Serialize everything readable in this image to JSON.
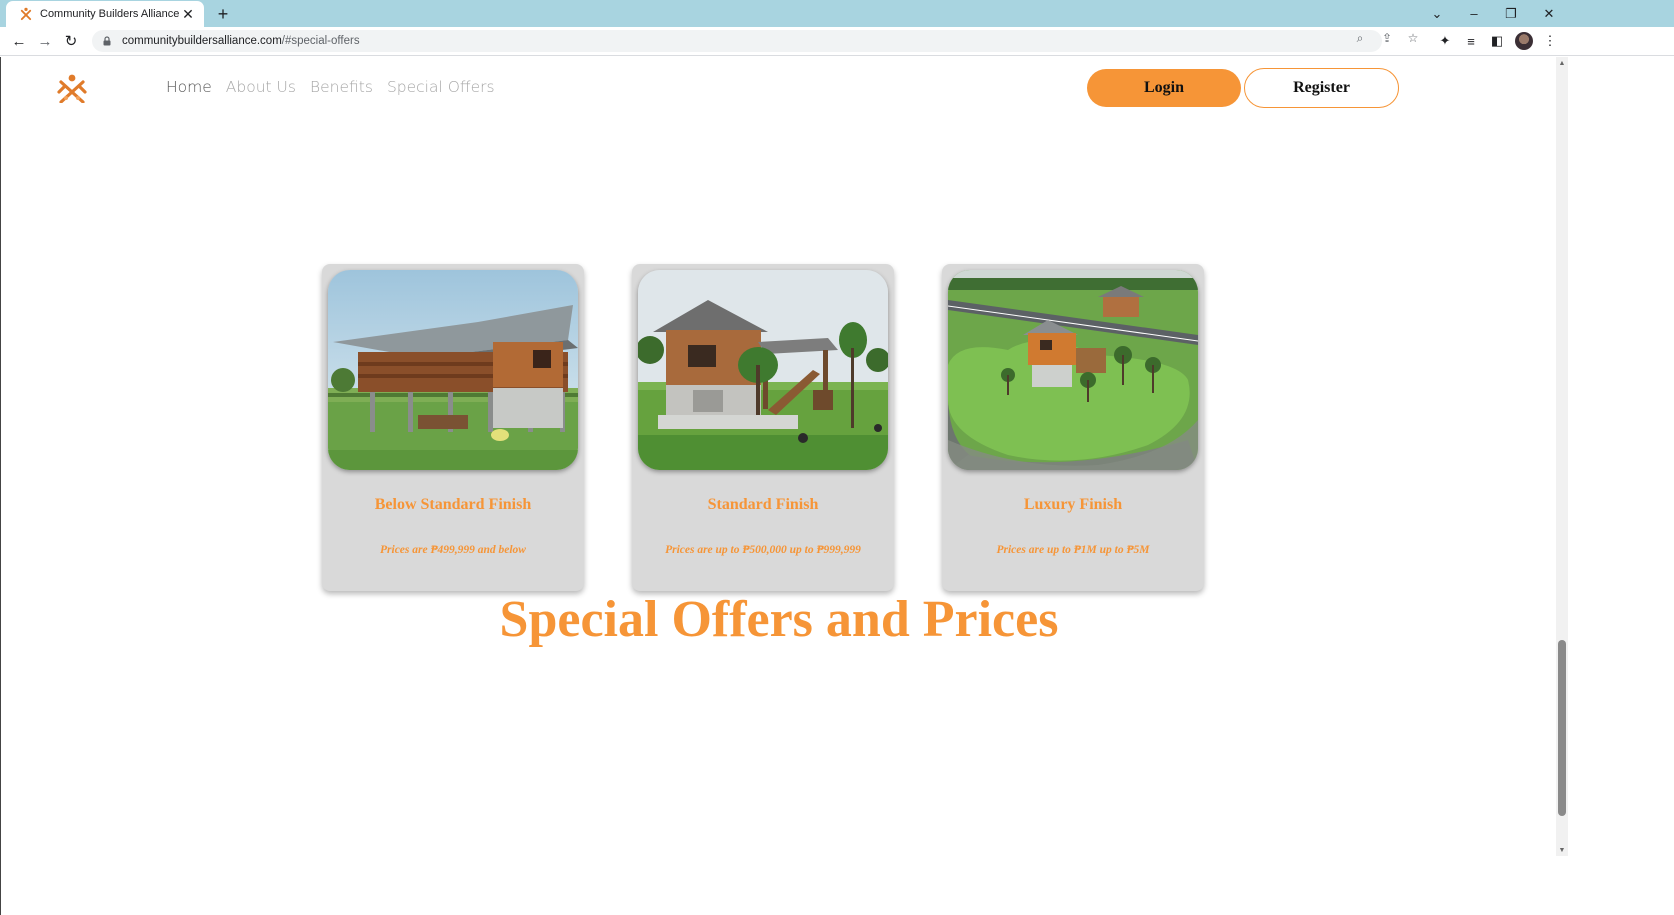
{
  "browser": {
    "tab_title": "Community Builders Alliance",
    "new_tab_symbol": "+",
    "close_symbol": "✕",
    "url_host": "communitybuildersalliance.com",
    "url_path": "/#special-offers",
    "theme_color": "#a8d4e0"
  },
  "site": {
    "brand_color": "#f69537",
    "nav": [
      {
        "label": "Home",
        "active": true
      },
      {
        "label": "About Us",
        "active": false
      },
      {
        "label": "Benefits",
        "active": false
      },
      {
        "label": "Special Offers",
        "active": false
      }
    ],
    "login_label": "Login",
    "register_label": "Register"
  },
  "offers": [
    {
      "title": "Below Standard Finish",
      "price": "Prices are ₱499,999 and below",
      "image": "stilt-house-photo"
    },
    {
      "title": "Standard Finish",
      "price": "Prices are up to ₱500,000 up to ₱999,999",
      "image": "wooden-house-garden-photo"
    },
    {
      "title": "Luxury Finish",
      "price": "Prices are up to ₱1M up to ₱5M",
      "image": "island-house-aerial-photo"
    }
  ],
  "section_title": "Special Offers and Prices"
}
